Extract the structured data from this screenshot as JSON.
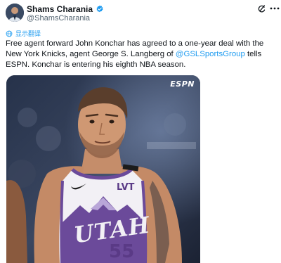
{
  "author": {
    "display_name": "Shams Charania",
    "handle": "@ShamsCharania",
    "verified": true
  },
  "actions": {
    "grok_icon": "grok-icon",
    "more_icon": "more-dots-icon"
  },
  "translate": {
    "label": "显示翻译"
  },
  "tweet": {
    "text_before": "Free agent forward John Konchar has agreed to a one-year deal with the New York Knicks, agent George S. Langberg of ",
    "mention": "@GSLSportsGroup",
    "text_after": " tells ESPN. Konchar is entering his eighth NBA season."
  },
  "media": {
    "watermark": "ESPN",
    "jersey_sponsor": "LVT",
    "jersey_team": "UTAH",
    "jersey_number": "55"
  },
  "colors": {
    "link": "#1d9bf0",
    "verified": "#1d9bf0",
    "jersey_purple": "#6b4a9a",
    "jersey_white": "#f2f0f5"
  }
}
